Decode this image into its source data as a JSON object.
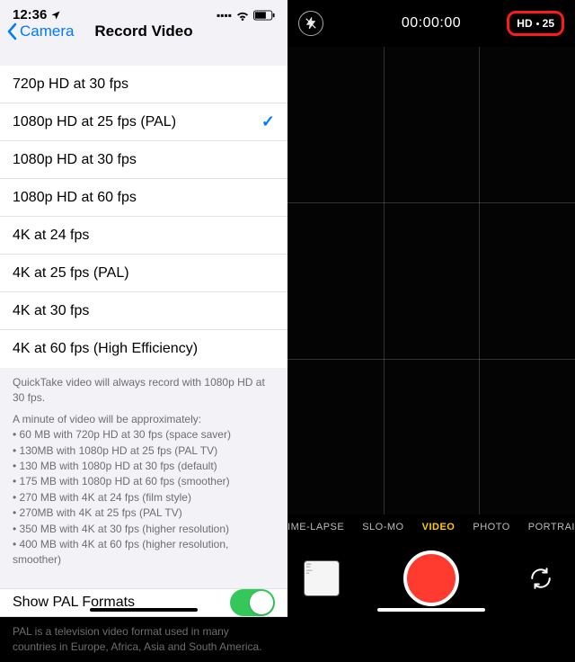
{
  "status": {
    "time": "12:36",
    "location_glyph": "➤",
    "signal_glyph": "•ı|",
    "wifi_glyph": "",
    "battery_glyph": ""
  },
  "nav": {
    "back_label": "Camera",
    "title": "Record Video"
  },
  "options": [
    {
      "label": "720p HD at 30 fps",
      "selected": false
    },
    {
      "label": "1080p HD at 25 fps (PAL)",
      "selected": true
    },
    {
      "label": "1080p HD at 30 fps",
      "selected": false
    },
    {
      "label": "1080p HD at 60 fps",
      "selected": false
    },
    {
      "label": "4K at 24 fps",
      "selected": false
    },
    {
      "label": "4K at 25 fps (PAL)",
      "selected": false
    },
    {
      "label": "4K at 30 fps",
      "selected": false
    },
    {
      "label": "4K at 60 fps (High Efficiency)",
      "selected": false
    }
  ],
  "footer": {
    "quicktake": "QuickTake video will always record with 1080p HD at 30 fps.",
    "minute_intro": "A minute of video will be approximately:",
    "sizes": [
      "• 60 MB with 720p HD at 30 fps (space saver)",
      "• 130MB with 1080p HD at 25 fps (PAL TV)",
      "• 130 MB with 1080p HD at 30 fps (default)",
      "• 175 MB with 1080p HD at 60 fps (smoother)",
      "• 270 MB with 4K at 24 fps (film style)",
      "• 270MB with 4K at 25 fps (PAL TV)",
      "• 350 MB with 4K at 30 fps (higher resolution)",
      "• 400 MB with 4K at 60 fps (higher resolution, smoother)"
    ]
  },
  "toggle": {
    "label": "Show PAL Formats",
    "on": true,
    "description": "PAL is a television video format used in many countries in Europe, Africa, Asia and South America."
  },
  "camera": {
    "timer": "00:00:00",
    "format_badge": {
      "res": "HD",
      "fps": "25"
    },
    "modes": [
      "TIME-LAPSE",
      "SLO-MO",
      "VIDEO",
      "PHOTO",
      "PORTRAIT"
    ],
    "active_mode": "VIDEO"
  }
}
